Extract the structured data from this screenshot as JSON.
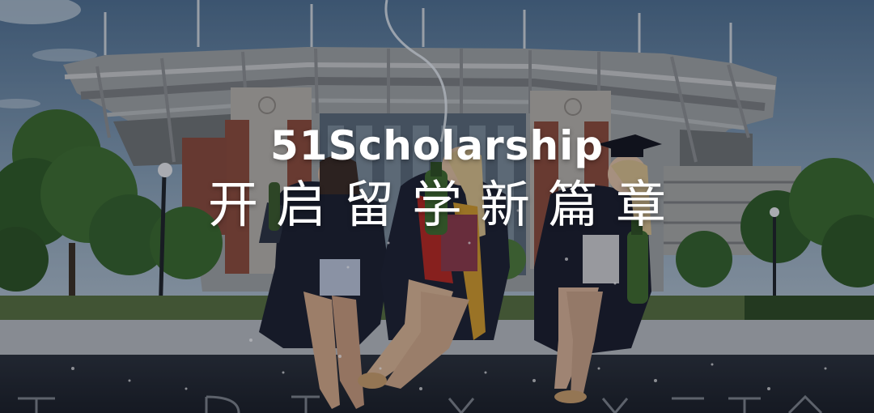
{
  "banner": {
    "title_en": "51Scholarship",
    "title_zh": "开启留学新篇章"
  },
  "scene": {
    "description_icons": [
      "stadium",
      "trees",
      "graduates",
      "champagne-bottle",
      "graduation-cap",
      "street-lamp"
    ],
    "colors": {
      "sky_top": "#5d7f9e",
      "sky_bottom": "#a9bccb",
      "stadium_concrete": "#a4a6a6",
      "stadium_brick": "#8a4b3a",
      "grass": "#4f6a3a",
      "tree": "#2f5a28",
      "wall": "#242a33",
      "wall_top": "#b9bdc2",
      "gown": "#1c2030"
    }
  }
}
